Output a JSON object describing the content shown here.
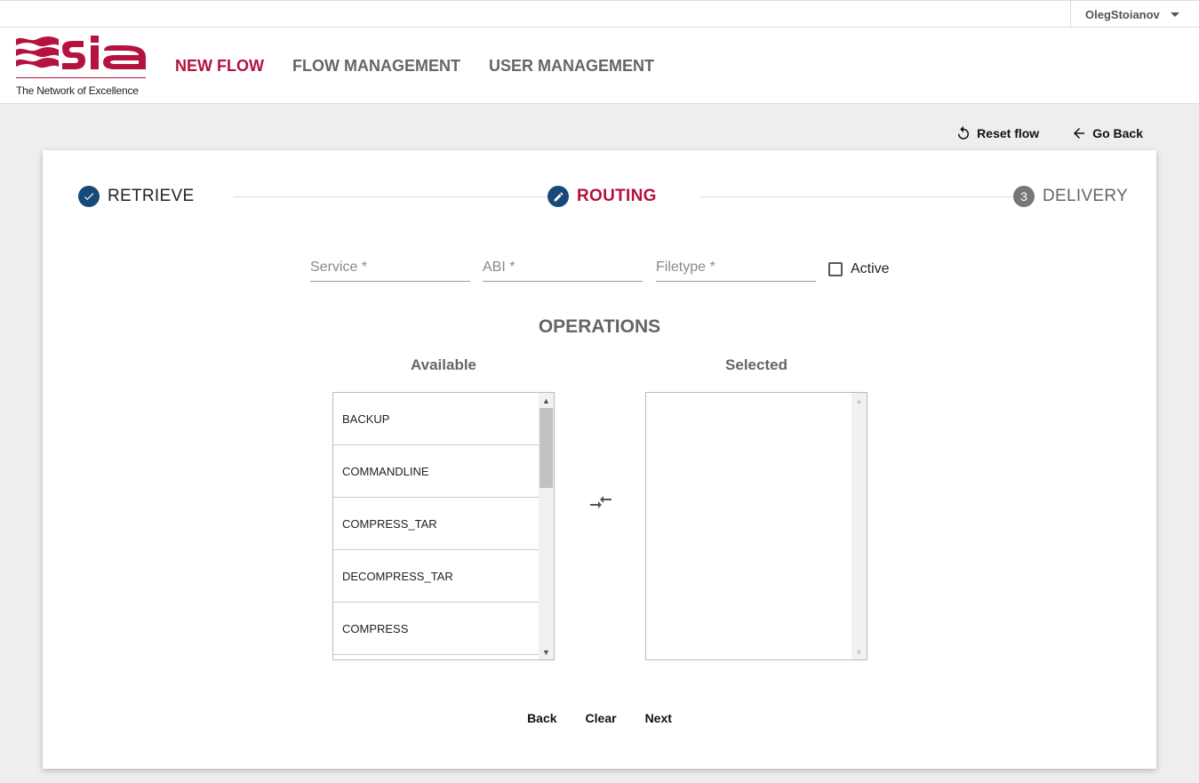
{
  "user": {
    "name": "OlegStoianov"
  },
  "brand": {
    "logo_text": "SIA",
    "tagline": "The Network of Excellence",
    "accent": "#b5123e"
  },
  "nav": {
    "items": [
      {
        "label": "NEW FLOW",
        "active": true
      },
      {
        "label": "FLOW MANAGEMENT",
        "active": false
      },
      {
        "label": "USER MANAGEMENT",
        "active": false
      }
    ]
  },
  "actions": {
    "reset": "Reset flow",
    "go_back": "Go Back"
  },
  "stepper": {
    "steps": [
      {
        "label": "RETRIEVE",
        "state": "done",
        "icon": "check-icon"
      },
      {
        "label": "ROUTING",
        "state": "current",
        "icon": "pencil-icon"
      },
      {
        "label": "DELIVERY",
        "state": "pending",
        "number": "3"
      }
    ]
  },
  "form": {
    "service_placeholder": "Service *",
    "abi_placeholder": "ABI *",
    "filetype_placeholder": "Filetype *",
    "active_label": "Active"
  },
  "operations": {
    "title": "OPERATIONS",
    "available_title": "Available",
    "selected_title": "Selected",
    "available": [
      "BACKUP",
      "COMMANDLINE",
      "COMPRESS_TAR",
      "DECOMPRESS_TAR",
      "COMPRESS"
    ],
    "selected": []
  },
  "buttons": {
    "back": "Back",
    "clear": "Clear",
    "next": "Next"
  }
}
